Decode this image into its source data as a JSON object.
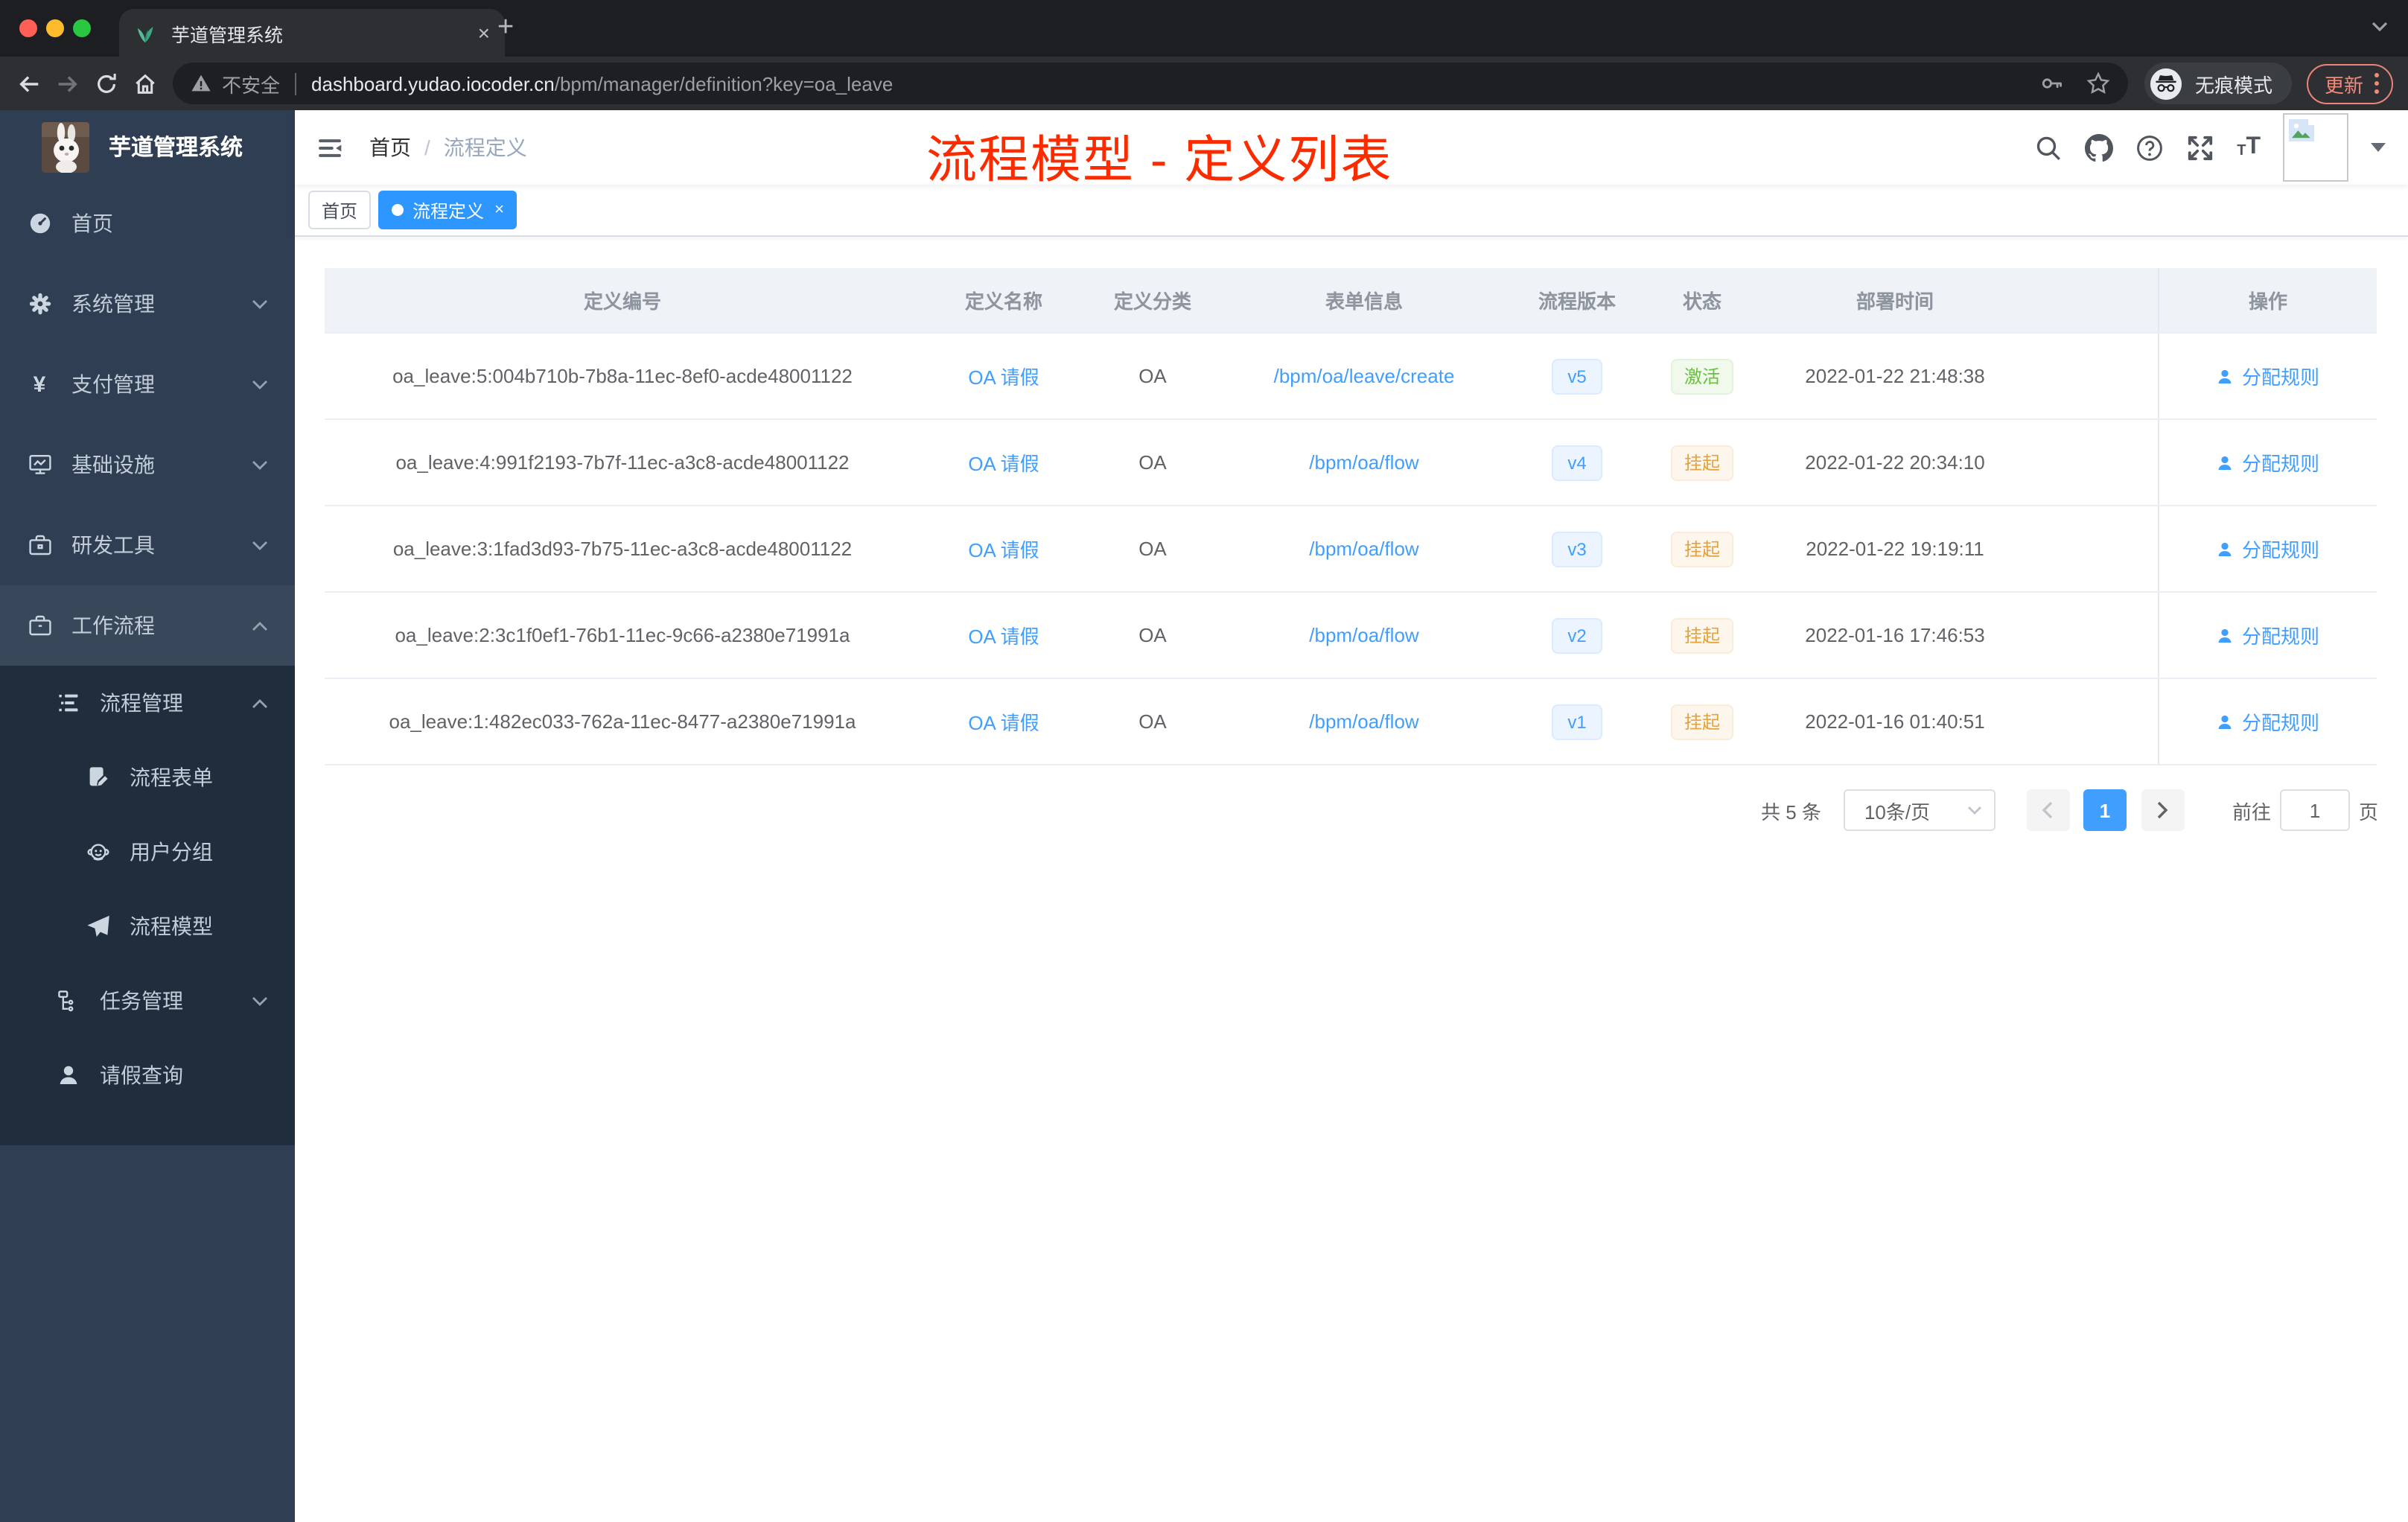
{
  "browser": {
    "tab_title": "芋道管理系统",
    "security_label": "不安全",
    "url_domain": "dashboard.yudao.iocoder.cn",
    "url_path": "/bpm/manager/definition?key=oa_leave",
    "incognito_label": "无痕模式",
    "update_label": "更新"
  },
  "sidebar": {
    "logo_title": "芋道管理系统",
    "items": [
      {
        "label": "首页"
      },
      {
        "label": "系统管理"
      },
      {
        "label": "支付管理"
      },
      {
        "label": "基础设施"
      },
      {
        "label": "研发工具"
      },
      {
        "label": "工作流程"
      },
      {
        "label": "流程管理"
      },
      {
        "label": "流程表单"
      },
      {
        "label": "用户分组"
      },
      {
        "label": "流程模型"
      },
      {
        "label": "任务管理"
      },
      {
        "label": "请假查询"
      }
    ]
  },
  "header": {
    "breadcrumb_home": "首页",
    "breadcrumb_sep": "/",
    "breadcrumb_current": "流程定义",
    "annotation": "流程模型 - 定义列表"
  },
  "tags": {
    "home": "首页",
    "active": "流程定义",
    "close": "×"
  },
  "table": {
    "columns": [
      "定义编号",
      "定义名称",
      "定义分类",
      "表单信息",
      "流程版本",
      "状态",
      "部署时间",
      "操作"
    ],
    "rows": [
      {
        "id": "oa_leave:5:004b710b-7b8a-11ec-8ef0-acde48001122",
        "name": "OA 请假",
        "category": "OA",
        "form": "/bpm/oa/leave/create",
        "version": "v5",
        "status": "激活",
        "deploy_time": "2022-01-22 21:48:38",
        "action": "分配规则"
      },
      {
        "id": "oa_leave:4:991f2193-7b7f-11ec-a3c8-acde48001122",
        "name": "OA 请假",
        "category": "OA",
        "form": "/bpm/oa/flow",
        "version": "v4",
        "status": "挂起",
        "deploy_time": "2022-01-22 20:34:10",
        "action": "分配规则"
      },
      {
        "id": "oa_leave:3:1fad3d93-7b75-11ec-a3c8-acde48001122",
        "name": "OA 请假",
        "category": "OA",
        "form": "/bpm/oa/flow",
        "version": "v3",
        "status": "挂起",
        "deploy_time": "2022-01-22 19:19:11",
        "action": "分配规则"
      },
      {
        "id": "oa_leave:2:3c1f0ef1-76b1-11ec-9c66-a2380e71991a",
        "name": "OA 请假",
        "category": "OA",
        "form": "/bpm/oa/flow",
        "version": "v2",
        "status": "挂起",
        "deploy_time": "2022-01-16 17:46:53",
        "action": "分配规则"
      },
      {
        "id": "oa_leave:1:482ec033-762a-11ec-8477-a2380e71991a",
        "name": "OA 请假",
        "category": "OA",
        "form": "/bpm/oa/flow",
        "version": "v1",
        "status": "挂起",
        "deploy_time": "2022-01-16 01:40:51",
        "action": "分配规则"
      }
    ]
  },
  "pagination": {
    "total": "共 5 条",
    "page_size": "10条/页",
    "current": "1",
    "goto": "前往",
    "goto_value": "1",
    "page_unit": "页"
  },
  "colors": {
    "accent_blue": "#409eff",
    "annotation_red": "#fb2b00",
    "status_active_green": "#67c23a",
    "status_suspend_orange": "#e6a23c",
    "sidebar_bg": "#2f3e52",
    "submenu_bg": "#1f2d3d",
    "active_tag_blue": "#2e97ff"
  },
  "icons": {
    "tab-favicon": "green seedling",
    "back-icon": "←",
    "forward-icon": "→",
    "reload-icon": "↻",
    "home-icon": "⌂",
    "warning-icon": "⚠",
    "key-icon": "key",
    "star-icon": "☆",
    "incognito-icon": "hat+glasses",
    "kebab-icon": "⋮",
    "chevron-down-icon": "∨",
    "chevron-up-icon": "∧",
    "hamburger-icon": "fold menu",
    "search-icon": "🔍",
    "github-icon": "octocat",
    "help-icon": "?",
    "fullscreen-icon": "expand arrows",
    "font-size-icon": "TT",
    "broken-image-icon": "image placeholder",
    "caret-icon": "▾",
    "sidebar-dashboard-icon": "gauge",
    "sidebar-gear-icon": "⚙",
    "sidebar-yen-icon": "¥",
    "sidebar-monitor-icon": "monitor chart",
    "sidebar-toolbox-icon": "briefcase",
    "sidebar-workflow-icon": "suitcase",
    "sidebar-list-icon": "tree list",
    "sidebar-form-icon": "doc+pencil",
    "sidebar-usergroup-icon": "face",
    "sidebar-plane-icon": "paper plane",
    "sidebar-task-icon": "org tree",
    "sidebar-user-icon": "person",
    "action-user-icon": "person",
    "pagination-prev-icon": "‹",
    "pagination-next-icon": "›"
  }
}
